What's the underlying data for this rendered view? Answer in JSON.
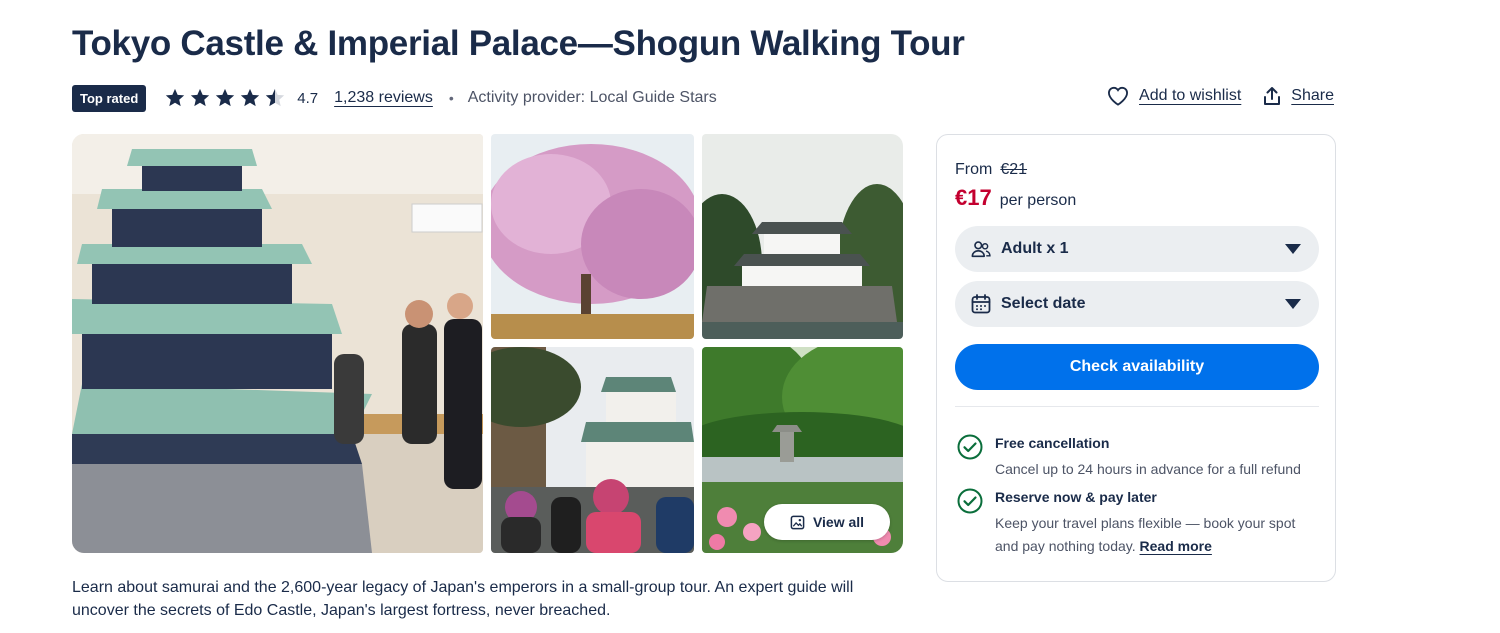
{
  "title": "Tokyo Castle & Imperial Palace—Shogun Walking Tour",
  "badge": "Top rated",
  "rating": {
    "value": "4.7",
    "stars": 4.7,
    "reviews_label": "1,238 reviews"
  },
  "separator": "•",
  "provider": "Activity provider: Local Guide Stars",
  "actions": {
    "wishlist": "Add to wishlist",
    "share": "Share"
  },
  "gallery": {
    "view_all": "View all"
  },
  "description": "Learn about samurai and the 2,600-year legacy of Japan's emperors in a small-group tour. An expert guide will uncover the secrets of Edo Castle, Japan's largest fortress, never breached.",
  "booking": {
    "from_label": "From",
    "old_price": "€21",
    "price": "€17",
    "per_person": "per person",
    "participants": "Adult x 1",
    "date": "Select date",
    "cta": "Check availability",
    "features": [
      {
        "title": "Free cancellation",
        "body": "Cancel up to 24 hours in advance for a full refund"
      },
      {
        "title": "Reserve now & pay later",
        "body": "Keep your travel plans flexible — book your spot and pay nothing today.",
        "link": "Read more"
      }
    ]
  },
  "colors": {
    "brand_dark": "#1a2b49",
    "accent_blue": "#0071eb",
    "price_red": "#c3002f",
    "check_green": "#0a6e3b"
  }
}
